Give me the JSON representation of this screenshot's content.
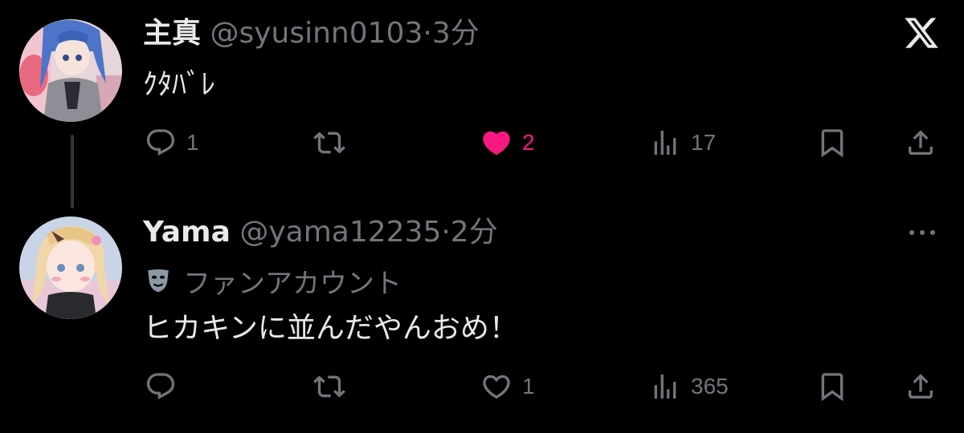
{
  "tweets": [
    {
      "name": "主真",
      "handle": "@syusinn0103",
      "separator": "·",
      "time": "3分",
      "text": "ｸﾀﾊﾞﾚ",
      "actions": {
        "reply_count": "1",
        "retweet_count": "",
        "like_count": "2",
        "liked": true,
        "view_count": "17"
      },
      "avatar_icon": "avatar-blue-hair-character"
    },
    {
      "name": "Yama",
      "handle": "@yama12235",
      "separator": "·",
      "time": "2分",
      "label_icon": "masks-icon",
      "label": "ファンアカウント",
      "text": "ヒカキンに並んだやんおめ！",
      "actions": {
        "reply_count": "",
        "retweet_count": "",
        "like_count": "1",
        "liked": false,
        "view_count": "365"
      },
      "avatar_icon": "avatar-blonde-hair-character"
    }
  ],
  "colors": {
    "background": "#000000",
    "primary_text": "#e7e9ea",
    "secondary_text": "#71767b",
    "like_pink": "#f91880"
  }
}
